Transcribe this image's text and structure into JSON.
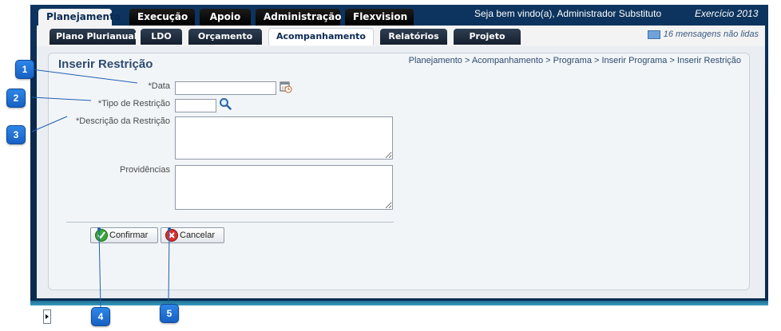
{
  "top_tabs": [
    {
      "label": "Planejamento",
      "active": true
    },
    {
      "label": "Execução",
      "active": false
    },
    {
      "label": "Apoio",
      "active": false
    },
    {
      "label": "Administração",
      "active": false
    },
    {
      "label": "Flexvision",
      "active": false
    }
  ],
  "header": {
    "welcome": "Seja bem vindo(a), Administrador Substituto",
    "exercicio": "Exercício 2013"
  },
  "sub_tabs": [
    {
      "label": "Plano Plurianual",
      "active": false
    },
    {
      "label": "LDO",
      "active": false
    },
    {
      "label": "Orçamento",
      "active": false
    },
    {
      "label": "Acompanhamento",
      "active": true
    },
    {
      "label": "Relatórios",
      "active": false
    },
    {
      "label": "Projeto",
      "active": false
    }
  ],
  "messages": "16 mensagens não lidas",
  "page": {
    "title": "Inserir Restrição",
    "breadcrumb": "Planejamento > Acompanhamento > Programa > Inserir Programa > Inserir Restrição"
  },
  "form": {
    "required_mark": "*",
    "data_label": "Data",
    "tipo_label": "Tipo de Restrição",
    "descricao_label": "Descrição da Restrição",
    "providencias_label": "Providências",
    "data_value": "",
    "tipo_value": "",
    "descricao_value": "",
    "providencias_value": ""
  },
  "buttons": {
    "confirmar": "Confirmar",
    "cancelar": "Cancelar"
  },
  "callouts": [
    "1",
    "2",
    "3",
    "4",
    "5"
  ],
  "icons": {
    "calendar": "calendar-icon",
    "search": "search-icon",
    "confirm": "check-icon",
    "cancel": "close-icon",
    "messages": "envelope-icon"
  },
  "colors": {
    "frame": "#0b2d55",
    "callout": "#1f6fd6",
    "title": "#2d4b6e"
  }
}
